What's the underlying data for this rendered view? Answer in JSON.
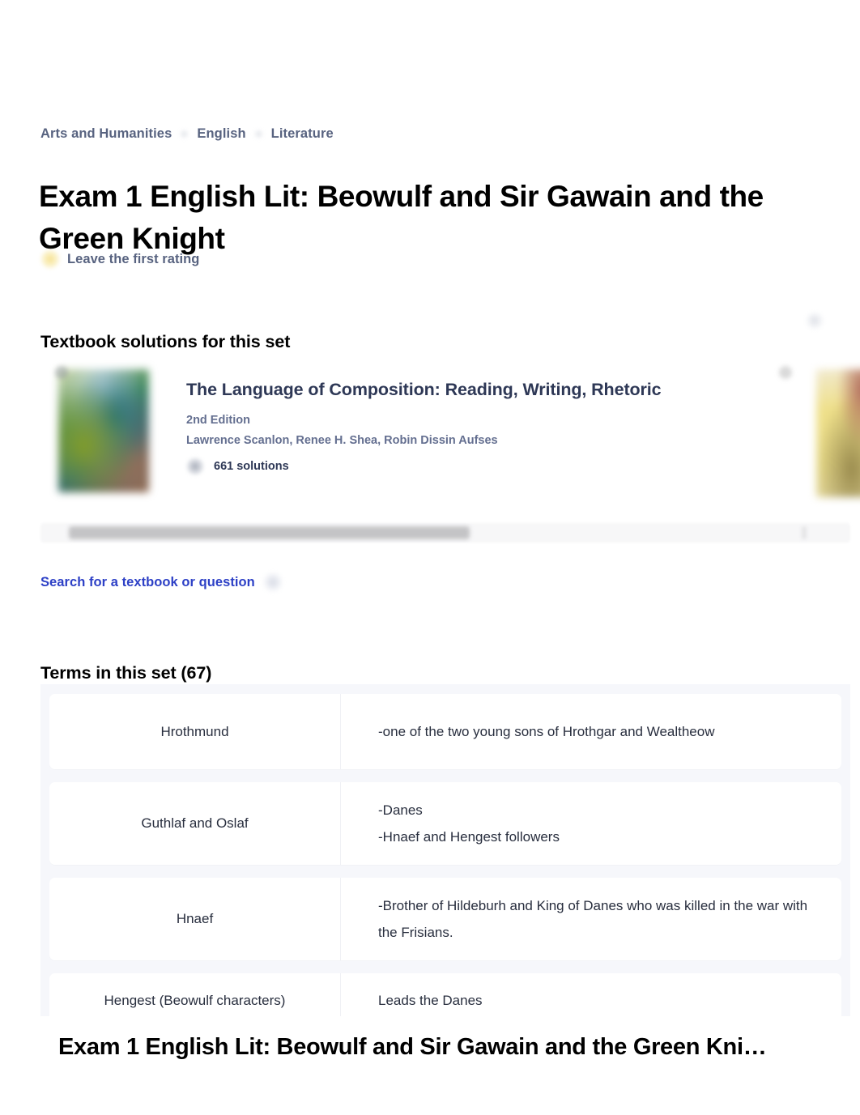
{
  "breadcrumb": {
    "items": [
      {
        "label": "Arts and Humanities"
      },
      {
        "label": "English"
      },
      {
        "label": "Literature"
      }
    ]
  },
  "header": {
    "title": "Exam 1 English Lit: Beowulf and Sir Gawain and the Green Knight",
    "rating": {
      "label": "Leave the first rating",
      "icon": "star-icon"
    }
  },
  "textbook_section": {
    "heading": "Textbook solutions for this set",
    "card": {
      "title": "The Language of Composition: Reading, Writing, Rhetoric",
      "edition": "2nd Edition",
      "authors": "Lawrence Scanlon, Renee H. Shea, Robin Dissin Aufses",
      "solutions": "661 solutions",
      "cover_icon": "book-cover-image"
    },
    "next_card": {
      "cover_icon": "book-cover-image"
    },
    "search_link": "Search for a textbook or question",
    "search_icon": "search-icon"
  },
  "terms_section": {
    "heading": "Terms in this set (67)",
    "count": 67,
    "rows": [
      {
        "term": "Hrothmund",
        "definition": "-one of the two young sons of Hrothgar and Wealtheow"
      },
      {
        "term": "Guthlaf and Oslaf",
        "definition": "-Danes\n-Hnaef and Hengest followers"
      },
      {
        "term": "Hnaef",
        "definition": "-Brother of Hildeburh and King of Danes who was killed in the war with the Frisians."
      },
      {
        "term": "Hengest (Beowulf characters)",
        "definition": "Leads the Danes"
      }
    ]
  },
  "bottom_bar": {
    "title": "Exam 1 English Lit: Beowulf and Sir Gawain and the Green Kni…"
  },
  "colors": {
    "link": "#2d40c6",
    "muted_text": "#586380",
    "body_text": "#282e3e",
    "card_title": "#2e3856",
    "list_background": "#f6f7fb",
    "star": "#f6e08a"
  }
}
